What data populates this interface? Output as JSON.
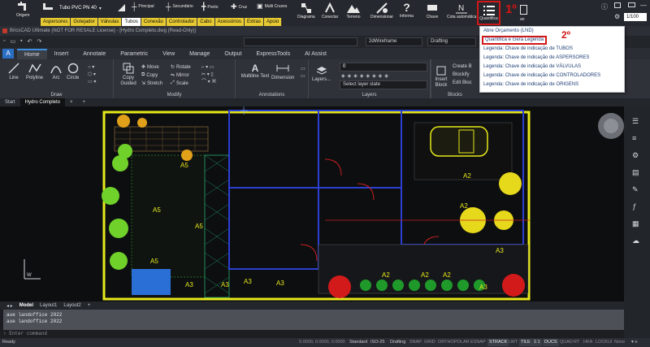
{
  "toolbar": {
    "origem": "Origem",
    "pipe_combo": "Tubo PVC PN 40",
    "principal": "Principal",
    "secundario": "Secundário",
    "ponto": "Ponto",
    "cruz": "Cruz",
    "multi_cruzes": "Multi Cruzes",
    "diagrama": "Diagrama",
    "conectar": "Conectar",
    "terreno": "Terreno",
    "dimensionar": "Dimensionar",
    "informa": "Informa",
    "chave": "Chave",
    "cota_automatica": "Cota automática",
    "quantifica": "Quantifica",
    "step1": "1º",
    "step1_sub": "an",
    "tabs": [
      "Aspersores",
      "Gotejador",
      "Válvulas",
      "Tubos",
      "Conexão",
      "Controlador",
      "Cabo",
      "Acessórios",
      "Extras",
      "Apoio"
    ],
    "zoom": "1/100"
  },
  "title": "BricsCAD Ultimate (NOT FOR RESALE License) - [Hydro Completo.dwg (Read-Only)]",
  "quick": {
    "visual_style": "2dWireframe",
    "workspace": "Drafting"
  },
  "ribbon_tabs": [
    "Home",
    "Insert",
    "Annotate",
    "Parametric",
    "View",
    "Manage",
    "Output",
    "ExpressTools",
    "AI Assist"
  ],
  "app_icon": "A",
  "ribbon": {
    "draw": {
      "label": "Draw",
      "line": "Line",
      "polyline": "Polyline",
      "arc": "Arc",
      "circle": "Circle"
    },
    "copy_guided": "Copy Guided",
    "modify": {
      "label": "Modify",
      "move": "Move",
      "rotate": "Rotate",
      "copy": "Copy",
      "mirror": "Mirror",
      "stretch": "Stretch",
      "scale": "Scale"
    },
    "annotations": {
      "label": "Annotations",
      "mtext": "Multiline Text",
      "dimension": "Dimension"
    },
    "layers": {
      "label": "Layers",
      "layers": "Layers...",
      "select_state": "Select layer state",
      "layer_value": "0"
    },
    "blocks": {
      "label": "Blocks",
      "insert": "Insert Block",
      "create": "Create B",
      "blockify": "Blockify",
      "edit": "Edit Bloc"
    }
  },
  "doc_tabs": [
    "Start",
    "Hydro Completo"
  ],
  "layout_tabs": [
    "Model",
    "Layout1",
    "Layout2"
  ],
  "command_history": [
    "aue landoffice 2022",
    "aue landoffice 2022"
  ],
  "command_prompt": "Enter command",
  "status": {
    "ready": "Ready",
    "coords": "0.0000, 0.0000, 0.0000",
    "std": "Standard",
    "iso": "ISO-25",
    "ws": "Drafting",
    "toggles": [
      {
        "label": "SNAP",
        "on": false
      },
      {
        "label": "GRID",
        "on": false
      },
      {
        "label": "ORTHO",
        "on": false
      },
      {
        "label": "POLAR",
        "on": false
      },
      {
        "label": "ESNAP",
        "on": false
      },
      {
        "label": "STRACK",
        "on": true
      },
      {
        "label": "LWT",
        "on": false
      },
      {
        "label": "TILE",
        "on": true
      },
      {
        "label": "1:1",
        "on": true
      },
      {
        "label": "DUCS",
        "on": true
      },
      {
        "label": "QUAD",
        "on": false
      },
      {
        "label": "RT",
        "on": false
      },
      {
        "label": "HKA",
        "on": false
      },
      {
        "label": "LOCKUI",
        "on": false
      },
      {
        "label": "None",
        "on": false
      }
    ]
  },
  "menu": {
    "items": [
      "Abre Orçamento (LND)",
      "Quantifica e Gera Legenda",
      "Legenda: Chave de indicação de TUBOS",
      "Legenda: Chave de indicação de ASPERSORES",
      "Legenda: Chave de indicação de VÁLVULAS",
      "Legenda: Chave de indicação de CONTROLADORES",
      "Legenda: Chave de indicação de ORIGENS"
    ],
    "step2": "2º"
  },
  "drawing_labels": [
    "A5",
    "A5",
    "A5",
    "A5",
    "A2",
    "A2",
    "A2",
    "A2",
    "A2",
    "A3",
    "A3",
    "A3",
    "A3",
    "A3",
    "A3"
  ],
  "ucs": {
    "w": "W",
    "y": "Y"
  },
  "colors": {
    "plugin_tab": "#e7c931",
    "highlight": "#d01818",
    "accent": "#3b8fe0"
  }
}
